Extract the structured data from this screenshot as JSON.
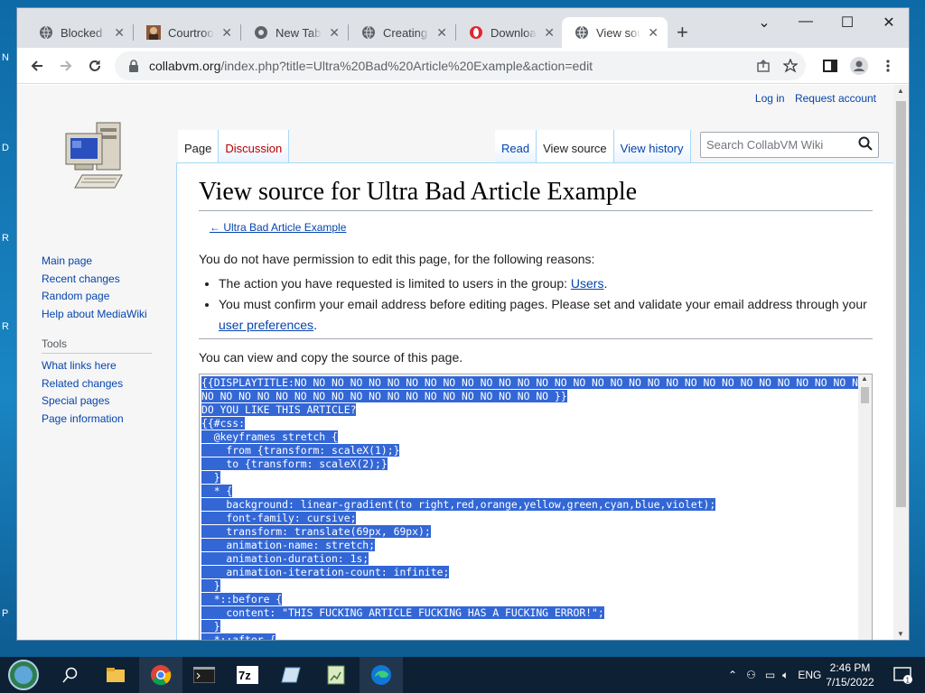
{
  "browser": {
    "tabs": [
      {
        "title": "Blocked by",
        "icon": "globe-icon"
      },
      {
        "title": "Courtroom",
        "icon": "avatar-icon"
      },
      {
        "title": "New Tab",
        "icon": "chrome-icon"
      },
      {
        "title": "Creating U",
        "icon": "globe-icon"
      },
      {
        "title": "Download",
        "icon": "opera-icon"
      },
      {
        "title": "View source",
        "icon": "globe-icon"
      }
    ],
    "url_host": "collabvm.org",
    "url_path": "/index.php?title=Ultra%20Bad%20Article%20Example&action=edit"
  },
  "wiki": {
    "personal": {
      "login": "Log in",
      "request": "Request account"
    },
    "nav": {
      "main": [
        "Main page",
        "Recent changes",
        "Random page",
        "Help about MediaWiki"
      ],
      "tools_heading": "Tools",
      "tools": [
        "What links here",
        "Related changes",
        "Special pages",
        "Page information"
      ]
    },
    "tabs_left": [
      "Page",
      "Discussion"
    ],
    "tabs_right": [
      "Read",
      "View source",
      "View history"
    ],
    "search_placeholder": "Search CollabVM Wiki",
    "title": "View source for Ultra Bad Article Example",
    "backlink": "← Ultra Bad Article Example",
    "permission_text": "You do not have permission to edit this page, for the following reasons:",
    "reason1_pre": "The action you have requested is limited to users in the group: ",
    "reason1_link": "Users",
    "reason1_post": ".",
    "reason2_pre": "You must confirm your email address before editing pages. Please set and validate your email address through your ",
    "reason2_link": "user preferences",
    "reason2_post": ".",
    "view_copy_text": "You can view and copy the source of this page.",
    "source_lines": [
      "{{DISPLAYTITLE:NO NO NO NO NO NO NO NO NO NO NO NO NO NO NO NO NO NO NO NO NO NO NO NO NO NO NO NO NO NO NO NO",
      "NO NO NO NO NO NO NO NO NO NO NO NO NO NO NO NO NO NO NO }}",
      "DO YOU LIKE THIS ARTICLE?",
      "{{#css:",
      "  @keyframes stretch {",
      "    from {transform: scaleX(1);}",
      "    to {transform: scaleX(2);}",
      "  }",
      "  * {",
      "    background: linear-gradient(to right,red,orange,yellow,green,cyan,blue,violet);",
      "    font-family: cursive;",
      "    transform: translate(69px, 69px);",
      "    animation-name: stretch;",
      "    animation-duration: 1s;",
      "    animation-iteration-count: infinite;",
      "  }",
      "  *::before {",
      "    content: \"THIS FUCKING ARTICLE FUCKING HAS A FUCKING ERROR!\";",
      "  }",
      "  *::after {"
    ]
  },
  "taskbar": {
    "lang": "ENG",
    "time": "2:46 PM",
    "date": "7/15/2022",
    "notifications": "1"
  }
}
